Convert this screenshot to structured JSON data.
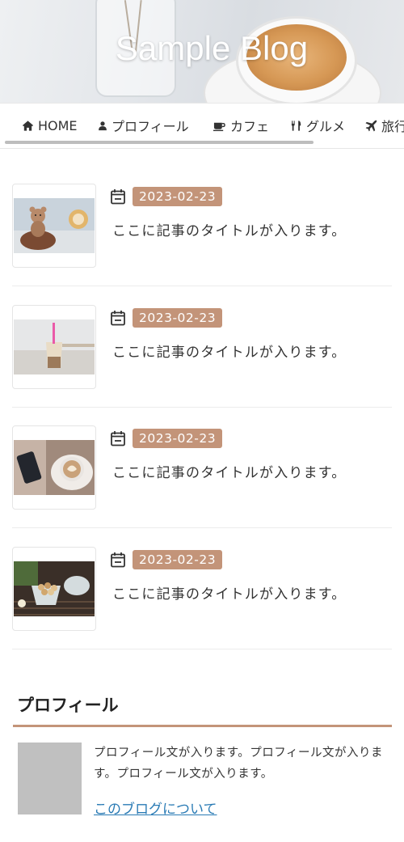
{
  "site": {
    "title": "Sample Blog"
  },
  "nav": {
    "items": [
      {
        "label": "HOME",
        "icon": "home-icon"
      },
      {
        "label": "プロフィール",
        "icon": "user-icon"
      },
      {
        "label": "カフェ",
        "icon": "coffee-icon"
      },
      {
        "label": "グルメ",
        "icon": "utensils-icon"
      },
      {
        "label": "旅行",
        "icon": "plane-icon"
      }
    ]
  },
  "articles": [
    {
      "date": "2023-02-23",
      "title": "ここに記事のタイトルが入ります。",
      "thumb": "teddy-bear-dessert"
    },
    {
      "date": "2023-02-23",
      "title": "ここに記事のタイトルが入ります。",
      "thumb": "bubble-tea"
    },
    {
      "date": "2023-02-23",
      "title": "ここに記事のタイトルが入ります。",
      "thumb": "latte-and-phone"
    },
    {
      "date": "2023-02-23",
      "title": "ここに記事のタイトルが入ります。",
      "thumb": "nut-snack-bowl"
    }
  ],
  "profile": {
    "heading": "プロフィール",
    "text": "プロフィール文が入ります。プロフィール文が入ります。プロフィール文が入ります。",
    "link": "このブログについて"
  },
  "colors": {
    "accent": "#c39479",
    "link": "#2a7bb5",
    "avatar_placeholder": "#c0c0c0"
  }
}
